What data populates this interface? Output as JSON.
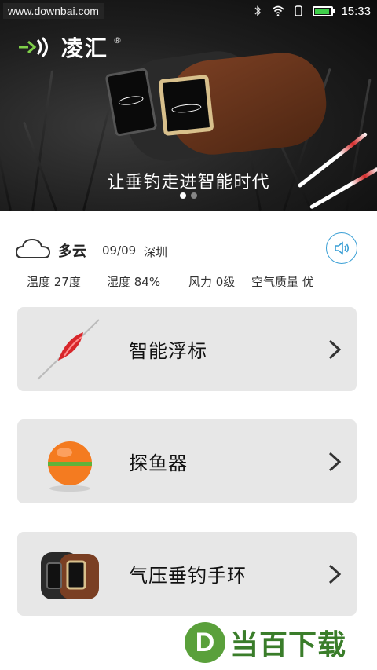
{
  "status_bar": {
    "watermark": "www.downbai.com",
    "time": "15:33",
    "icons": [
      "bluetooth-icon",
      "wifi-icon",
      "silent-icon",
      "battery-icon"
    ],
    "battery_percent": 90
  },
  "banner": {
    "logo_text": "凌汇",
    "logo_mark": "®",
    "caption": "让垂钓走进智能时代",
    "pager_count": 2,
    "pager_active": 0
  },
  "weather": {
    "icon": "cloud-icon",
    "condition": "多云",
    "date": "09/09",
    "city": "深圳",
    "speaker_icon": "speaker-icon",
    "temperature": "温度 27度",
    "humidity": "湿度 84%",
    "wind": "风力 0级",
    "air_quality": "空气质量 优"
  },
  "menu": {
    "items": [
      {
        "label": "智能浮标",
        "icon": "smart-float-icon"
      },
      {
        "label": "探鱼器",
        "icon": "fish-finder-icon"
      },
      {
        "label": "气压垂钓手环",
        "icon": "fishing-wristband-icon"
      }
    ]
  },
  "watermark_bottom": {
    "badge": "D",
    "text": "当百下载"
  },
  "colors": {
    "accent": "#3a9fd5",
    "card_bg": "#e7e7e7",
    "battery_green": "#3fce4a",
    "watermark_green": "#5aa03b"
  }
}
